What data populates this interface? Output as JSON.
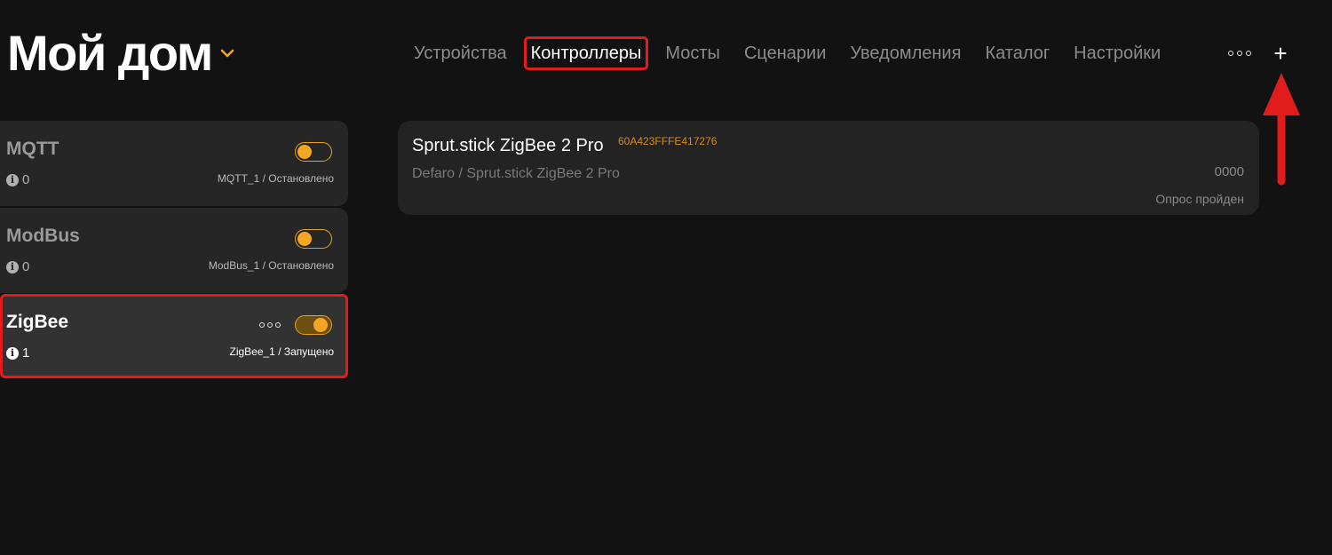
{
  "header": {
    "home_title": "Мой дом",
    "nav": [
      "Устройства",
      "Контроллеры",
      "Мосты",
      "Сценарии",
      "Уведомления",
      "Каталог",
      "Настройки"
    ],
    "active_nav": "Контроллеры",
    "plus_label": "+"
  },
  "colors": {
    "accent": "#f5a623",
    "highlight": "#e01c1c",
    "background": "#121212"
  },
  "controllers": [
    {
      "name": "MQTT",
      "count": "0",
      "status": "MQTT_1 / Остановлено",
      "enabled": false
    },
    {
      "name": "ModBus",
      "count": "0",
      "status": "ModBus_1 / Остановлено",
      "enabled": false
    },
    {
      "name": "ZigBee",
      "count": "1",
      "status": "ZigBee_1 / Запущено",
      "enabled": true
    }
  ],
  "device": {
    "name": "Sprut.stick ZigBee 2 Pro",
    "id": "60A423FFFE417276",
    "path": "Defaro / Sprut.stick ZigBee 2 Pro",
    "code": "0000",
    "status": "Опрос пройден"
  }
}
